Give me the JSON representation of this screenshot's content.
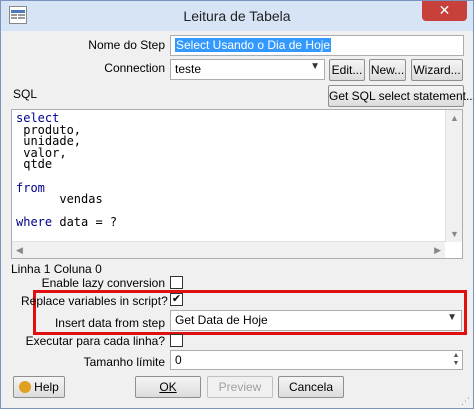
{
  "window": {
    "title": "Leitura de Tabela",
    "close_label": "✕"
  },
  "form": {
    "step_name_label": "Nome do Step",
    "step_name_value": "Select Usando o Dia de Hoje",
    "connection_label": "Connection",
    "connection_value": "teste",
    "edit_button": "Edit...",
    "new_button": "New...",
    "wizard_button": "Wizard...",
    "sql_label": "SQL",
    "get_sql_button": "Get SQL select statement...",
    "status_line": "Linha 1 Coluna 0",
    "lazy_label": "Enable lazy conversion",
    "lazy_checked": false,
    "replace_vars_label": "Replace variables in script?",
    "replace_vars_checked": true,
    "insert_data_label": "Insert data from step",
    "insert_data_value": "Get Data de Hoje",
    "exec_each_label": "Executar para cada linha?",
    "exec_each_checked": false,
    "limit_label": "Tamanho límite",
    "limit_value": "0"
  },
  "sql": {
    "lines": [
      "select",
      " produto,",
      " unidade,",
      " valor,",
      " qtde",
      "",
      "from",
      "      vendas",
      "",
      "where data = ?"
    ]
  },
  "footer": {
    "help_button": "Help",
    "ok_button": "OK",
    "preview_button": "Preview",
    "cancel_button": "Cancela"
  },
  "colors": {
    "highlight_border": "#e01010",
    "selection": "#3399ff",
    "close_button": "#c7403a"
  }
}
